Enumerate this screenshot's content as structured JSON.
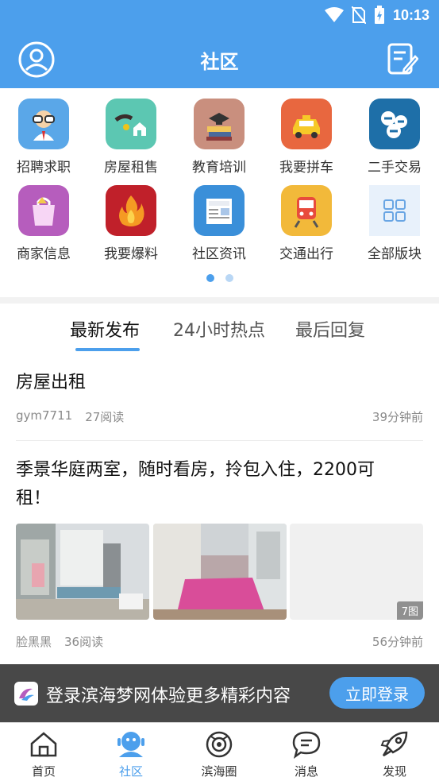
{
  "status": {
    "time": "10:13"
  },
  "header": {
    "title": "社区",
    "avatar_icon": "user-circle-icon",
    "compose_icon": "edit-note-icon"
  },
  "categories": [
    {
      "label": "招聘求职",
      "icon": "recruit-icon",
      "color": "#5aa7e8"
    },
    {
      "label": "房屋租售",
      "icon": "house-key-icon",
      "color": "#5cc7b2"
    },
    {
      "label": "教育培训",
      "icon": "books-icon",
      "color": "#c98f7e"
    },
    {
      "label": "我要拼车",
      "icon": "taxi-icon",
      "color": "#e8673f"
    },
    {
      "label": "二手交易",
      "icon": "trade-icon",
      "color": "#1e6fa8"
    },
    {
      "label": "商家信息",
      "icon": "shopping-bag-icon",
      "color": "#b65dbd"
    },
    {
      "label": "我要爆料",
      "icon": "fire-icon",
      "color": "#c0202a"
    },
    {
      "label": "社区资讯",
      "icon": "newspaper-icon",
      "color": "#3a8fd9"
    },
    {
      "label": "交通出行",
      "icon": "train-icon",
      "color": "#f2b93a"
    },
    {
      "label": "全部版块",
      "icon": "grid-icon",
      "color": "#e8f1fb"
    }
  ],
  "pager": {
    "active": 0,
    "count": 2,
    "active_color": "#4c9fec",
    "inactive_color": "#b9d7f5"
  },
  "tabs": [
    {
      "label": "最新发布",
      "active": true
    },
    {
      "label": "24小时热点",
      "active": false
    },
    {
      "label": "最后回复",
      "active": false
    }
  ],
  "posts": [
    {
      "title": "房屋出租",
      "author": "gym7711",
      "reads": "27阅读",
      "time": "39分钟前"
    },
    {
      "title_line1": "季景华庭两室，随时看房，拎包入住，2200可",
      "title_line2": "租！",
      "author": "脸黑黑",
      "reads": "36阅读",
      "time": "56分钟前",
      "image_count": "7图"
    }
  ],
  "login_banner": {
    "text": "登录滨海梦网体验更多精彩内容",
    "button": "立即登录"
  },
  "nav": [
    {
      "label": "首页",
      "icon": "home-icon",
      "active": false
    },
    {
      "label": "社区",
      "icon": "community-icon",
      "active": true
    },
    {
      "label": "滨海圈",
      "icon": "camera-circle-icon",
      "active": false
    },
    {
      "label": "消息",
      "icon": "chat-bubble-icon",
      "active": false
    },
    {
      "label": "发现",
      "icon": "rocket-icon",
      "active": false
    }
  ],
  "colors": {
    "accent": "#4c9fec",
    "header": "#4c9fec"
  }
}
